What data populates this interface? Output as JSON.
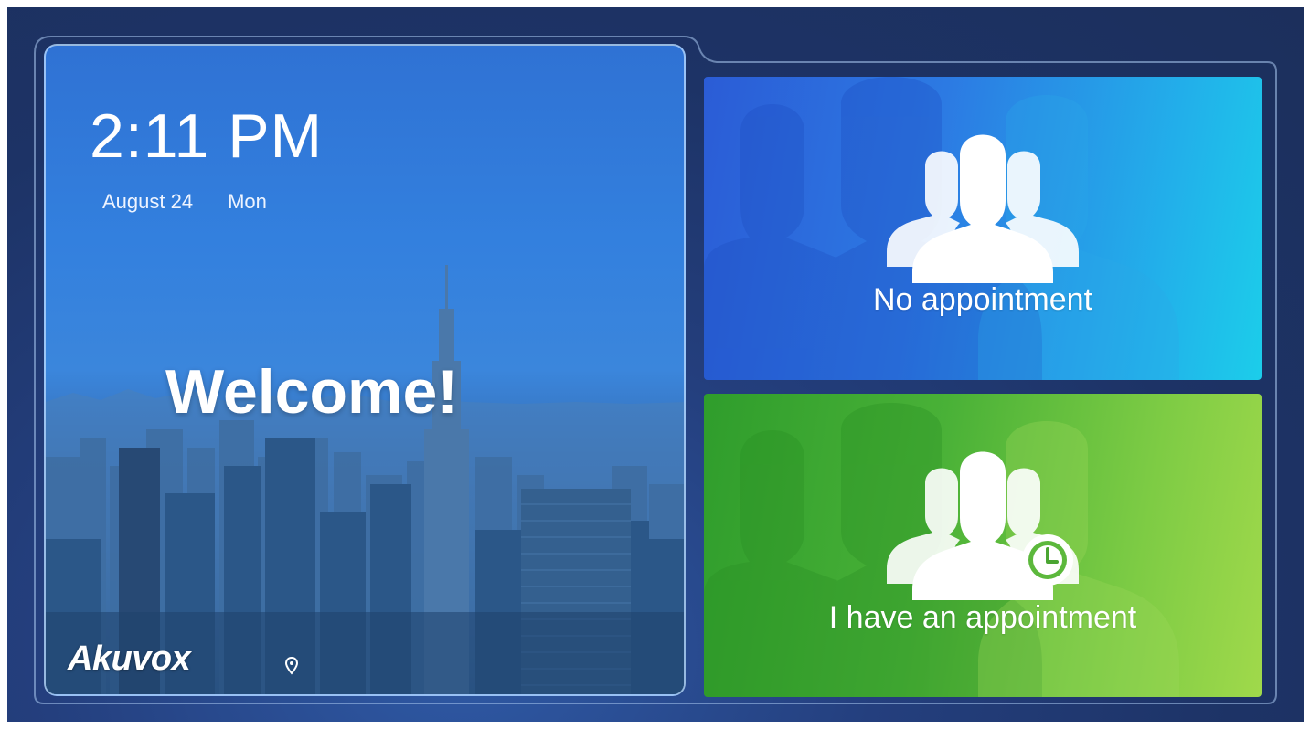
{
  "clock": {
    "time": "2:11 PM",
    "date": "August 24",
    "weekday": "Mon"
  },
  "welcome": {
    "message": "Welcome!"
  },
  "brand": {
    "name": "Akuvox"
  },
  "options": [
    {
      "label": "No appointment",
      "icon": "people-group-icon",
      "color": "#2c7ae3"
    },
    {
      "label": "I have an appointment",
      "icon": "people-group-clock-icon",
      "color": "#49b137"
    }
  ],
  "colors": {
    "background": "#1d3366",
    "welcome_panel": "#3380de",
    "no_appointment_card": "#22b0ea",
    "appointment_card": "#7ccb44"
  }
}
